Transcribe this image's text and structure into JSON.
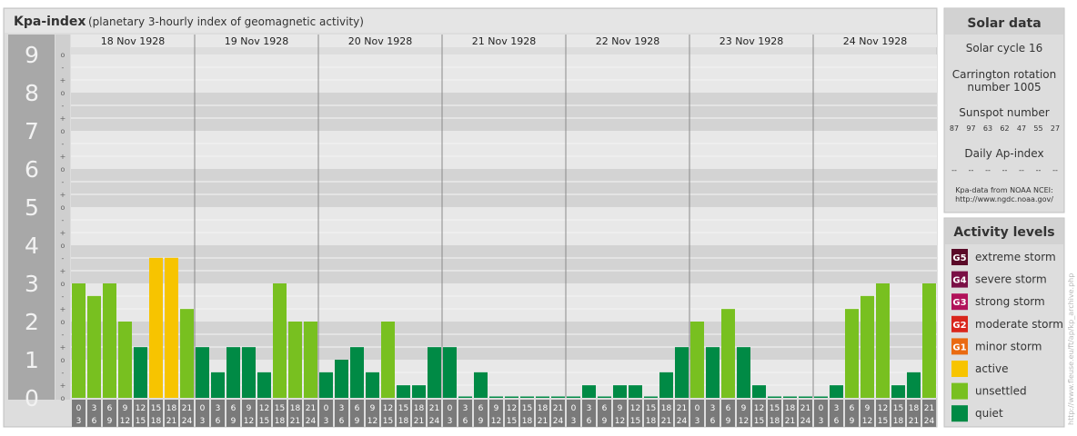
{
  "header": {
    "title": "Kpa-index",
    "subtitle": "(planetary 3-hourly index of geomagnetic activity)"
  },
  "solar": {
    "title": "Solar data",
    "cycle": "Solar cycle 16",
    "carrington_line1": "Carrington rotation",
    "carrington_line2": "number 1005",
    "sunspot_title": "Sunspot number",
    "sunspots": [
      "87",
      "97",
      "63",
      "62",
      "47",
      "55",
      "27"
    ],
    "ap_title": "Daily Ap-index",
    "ap_values": [
      "--",
      "--",
      "--",
      "--",
      "--",
      "--",
      "--"
    ],
    "source_line1": "Kpa-data from NOAA NCEI:",
    "source_line2": "http://www.ngdc.noaa.gov/"
  },
  "activity": {
    "title": "Activity levels",
    "levels": [
      {
        "badge": "G5",
        "label": "extreme storm",
        "color": "#5a0a28"
      },
      {
        "badge": "G4",
        "label": "severe storm",
        "color": "#7a0f45"
      },
      {
        "badge": "G3",
        "label": "strong storm",
        "color": "#b1125a"
      },
      {
        "badge": "G2",
        "label": "moderate storm",
        "color": "#d9261c"
      },
      {
        "badge": "G1",
        "label": "minor storm",
        "color": "#ea6a10"
      },
      {
        "badge": "",
        "label": "active",
        "color": "#f7c400"
      },
      {
        "badge": "",
        "label": "unsettled",
        "color": "#78c020"
      },
      {
        "badge": "",
        "label": "quiet",
        "color": "#008a45"
      }
    ]
  },
  "watermark": "http://www.fleuse.eu/ft/ap/kp_archive.php",
  "chart_data": {
    "type": "bar",
    "ylim": [
      0,
      9
    ],
    "y_ticks": [
      "0",
      "1",
      "2",
      "3",
      "4",
      "5",
      "6",
      "7",
      "8",
      "9"
    ],
    "minor_labels": [
      "o",
      "+",
      "-",
      "o"
    ],
    "days": [
      "18 Nov 1928",
      "19 Nov 1928",
      "20 Nov 1928",
      "21 Nov 1928",
      "22 Nov 1928",
      "23 Nov 1928",
      "24 Nov 1928"
    ],
    "interval_start": [
      "0",
      "3",
      "6",
      "9",
      "12",
      "15",
      "18",
      "21"
    ],
    "interval_end": [
      "3",
      "6",
      "9",
      "12",
      "15",
      "18",
      "21",
      "24"
    ],
    "colors": {
      "quiet": "#008a45",
      "unsettled": "#78c020",
      "active": "#f7c400"
    },
    "values": [
      3.0,
      2.67,
      3.0,
      2.0,
      1.33,
      3.67,
      3.67,
      2.33,
      1.33,
      0.67,
      1.33,
      1.33,
      0.67,
      3.0,
      2.0,
      2.0,
      0.67,
      1.0,
      1.33,
      0.67,
      2.0,
      0.33,
      0.33,
      1.33,
      1.33,
      0.0,
      0.67,
      0.0,
      0.0,
      0.0,
      0.0,
      0.0,
      0.0,
      0.33,
      0.0,
      0.33,
      0.33,
      0.0,
      0.67,
      1.33,
      2.0,
      1.33,
      2.33,
      1.33,
      0.33,
      0.0,
      0.0,
      0.0,
      0.0,
      0.33,
      2.33,
      2.67,
      3.0,
      0.33,
      0.67,
      3.0
    ]
  }
}
